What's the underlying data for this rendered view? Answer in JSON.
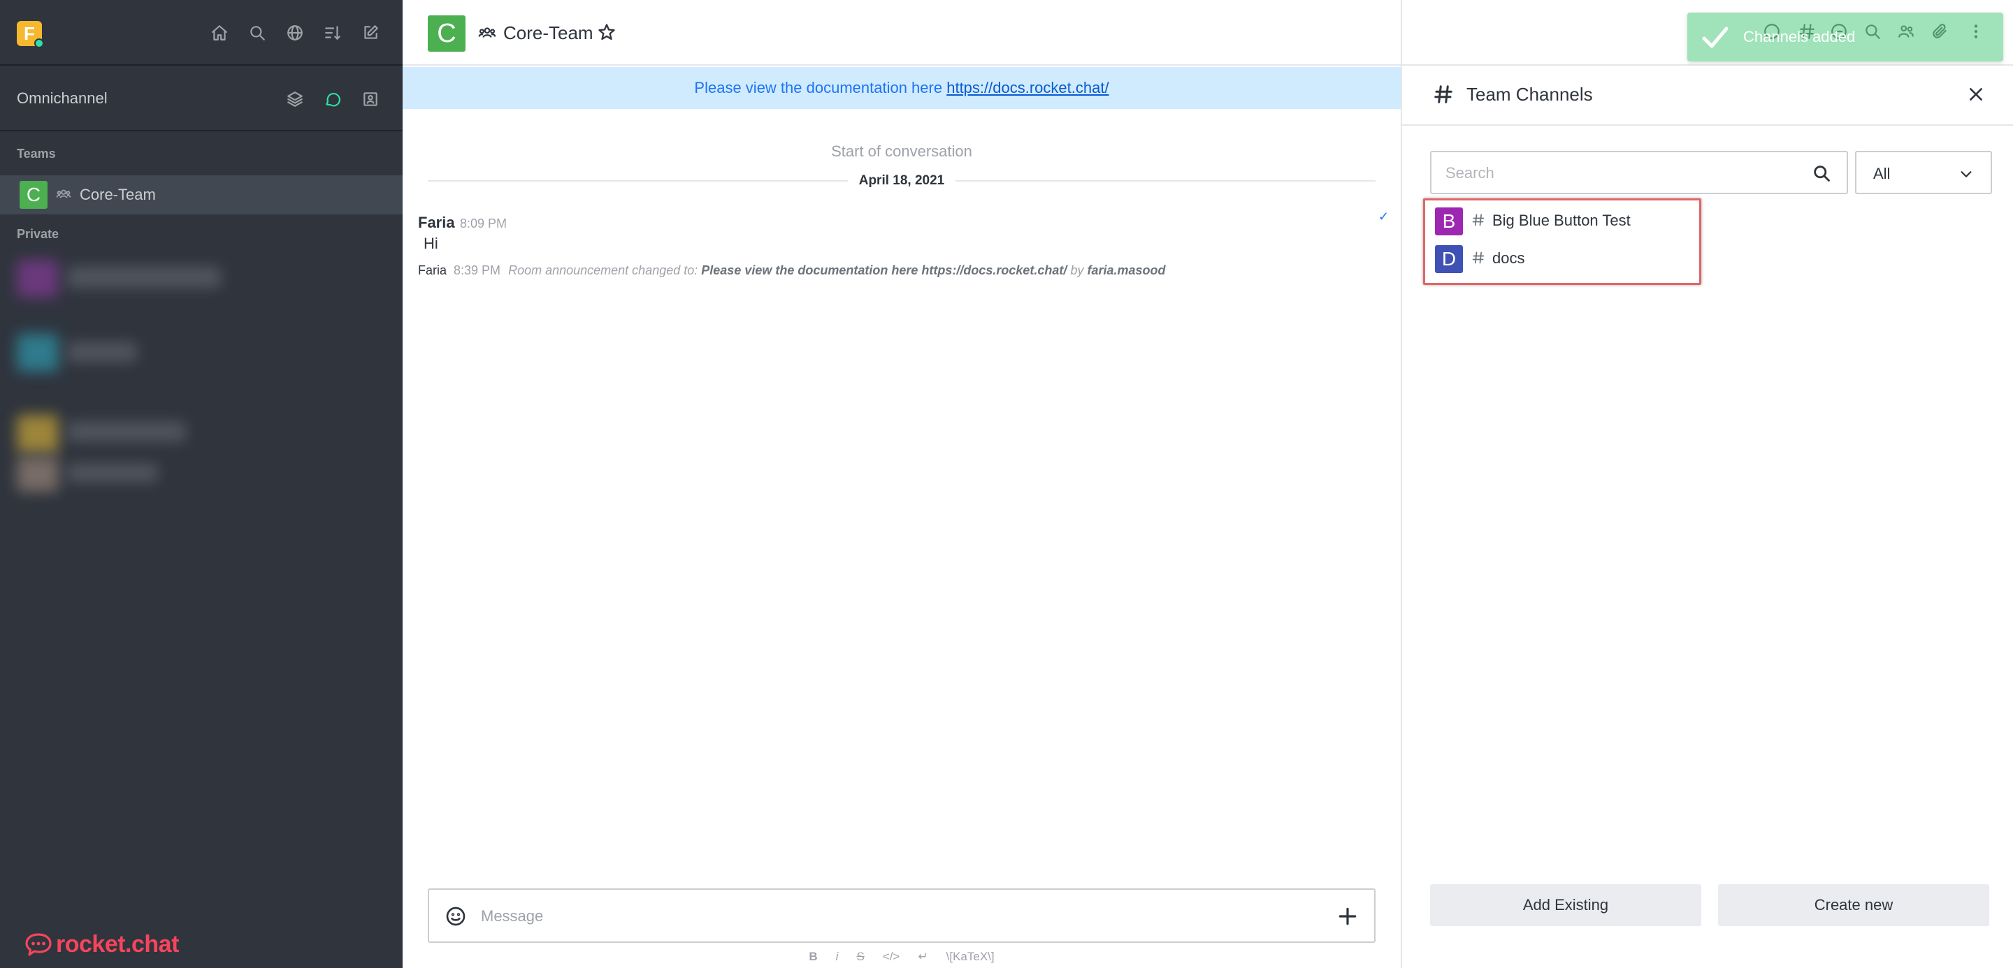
{
  "sidebar": {
    "workspace_initial": "F",
    "omnichannel_label": "Omnichannel",
    "sections": {
      "teams": "Teams",
      "private": "Private"
    },
    "team_item": {
      "initial": "C",
      "name": "Core-Team"
    },
    "brand": "rocket.chat"
  },
  "room": {
    "avatar_initial": "C",
    "title": "Core-Team",
    "announcement_text": "Please view the documentation here",
    "announcement_link": "https://docs.rocket.chat/",
    "start_label": "Start of conversation",
    "date_label": "April 18, 2021",
    "messages": [
      {
        "author": "Faria",
        "time": "8:09 PM",
        "text": "Hi"
      }
    ],
    "system_message": {
      "author": "Faria",
      "time": "8:39 PM",
      "prefix": "Room announcement changed to:",
      "content": "Please view the documentation here https://docs.rocket.chat/",
      "by_label": "by",
      "by_user": "faria.masood"
    },
    "composer_placeholder": "Message",
    "format_bar": [
      "B",
      "i",
      "S",
      "</>",
      "↵",
      "\\[KaTeX\\]"
    ]
  },
  "contextual_bar": {
    "toast_text": "Channels added",
    "title": "Team Channels",
    "search_placeholder": "Search",
    "filter_value": "All",
    "channels": [
      {
        "initial": "B",
        "name": "Big Blue Button Test",
        "color": "#9c27b0"
      },
      {
        "initial": "D",
        "name": "docs",
        "color": "#3f51b5"
      }
    ],
    "add_existing_label": "Add Existing",
    "create_new_label": "Create new"
  },
  "colors": {
    "sidebar_bg": "#2f343d",
    "accent_green": "#4caf50",
    "link_blue": "#095ad2",
    "announcement_bg": "#d1ebfe",
    "brand_red": "#f5455c",
    "highlight_border": "#e06666"
  }
}
